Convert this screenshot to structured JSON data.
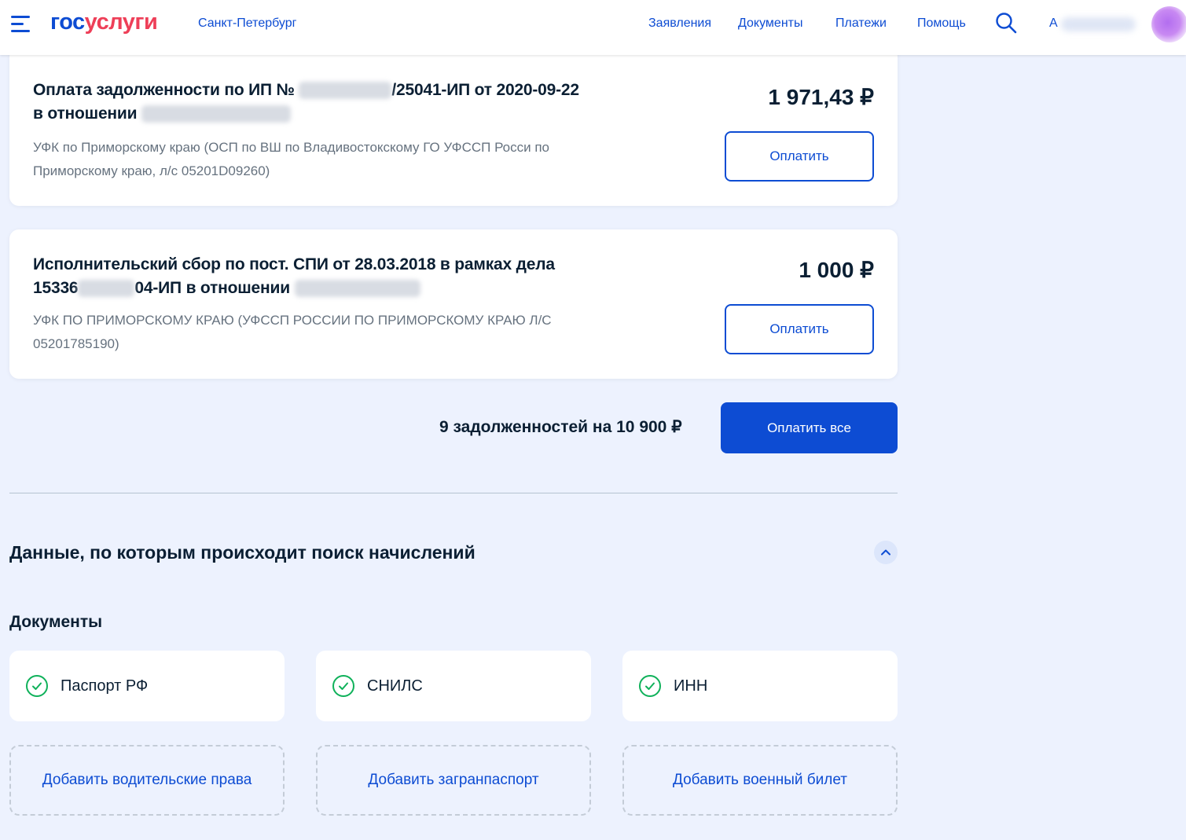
{
  "header": {
    "logo_part1": "гос",
    "logo_part2": "услуги",
    "city": "Санкт-Петербург",
    "nav": [
      "Заявления",
      "Документы",
      "Платежи",
      "Помощь"
    ],
    "user_initial": "А"
  },
  "debts": [
    {
      "title_prefix": "Оплата задолженности по ИП №",
      "title_middle": "/25041-ИП от 2020-09-22",
      "title_line2": "в отношении",
      "subtitle": "УФК по Приморскому краю (ОСП по ВШ по Владивостокскому ГО УФССП Росси по Приморскому краю, л/с 05201D09260)",
      "amount": "1 971,43 ₽",
      "pay_label": "Оплатить"
    },
    {
      "title_line1": "Исполнительский сбор по пост. СПИ от 28.03.2018 в рамках дела",
      "title_line2_a": "15336",
      "title_line2_b": "04-ИП в отношении",
      "subtitle": "УФК ПО ПРИМОРСКОМУ КРАЮ (УФССП РОССИИ ПО ПРИМОРСКОМУ КРАЮ Л/С 05201785190)",
      "amount": "1 000 ₽",
      "pay_label": "Оплатить"
    }
  ],
  "summary": {
    "text": "9 задолженностей на 10 900 ₽",
    "pay_all_label": "Оплатить все"
  },
  "search_section": {
    "title": "Данные, по которым происходит поиск начислений",
    "documents_title": "Документы",
    "documents": [
      "Паспорт РФ",
      "СНИЛС",
      "ИНН"
    ],
    "add_buttons": [
      "Добавить водительские права",
      "Добавить загранпаспорт",
      "Добавить военный билет"
    ]
  },
  "colors": {
    "brand_blue": "#0d4cd3",
    "brand_red": "#ee3f58",
    "check_green": "#0fb15a",
    "page_bg": "#edf2fe"
  }
}
